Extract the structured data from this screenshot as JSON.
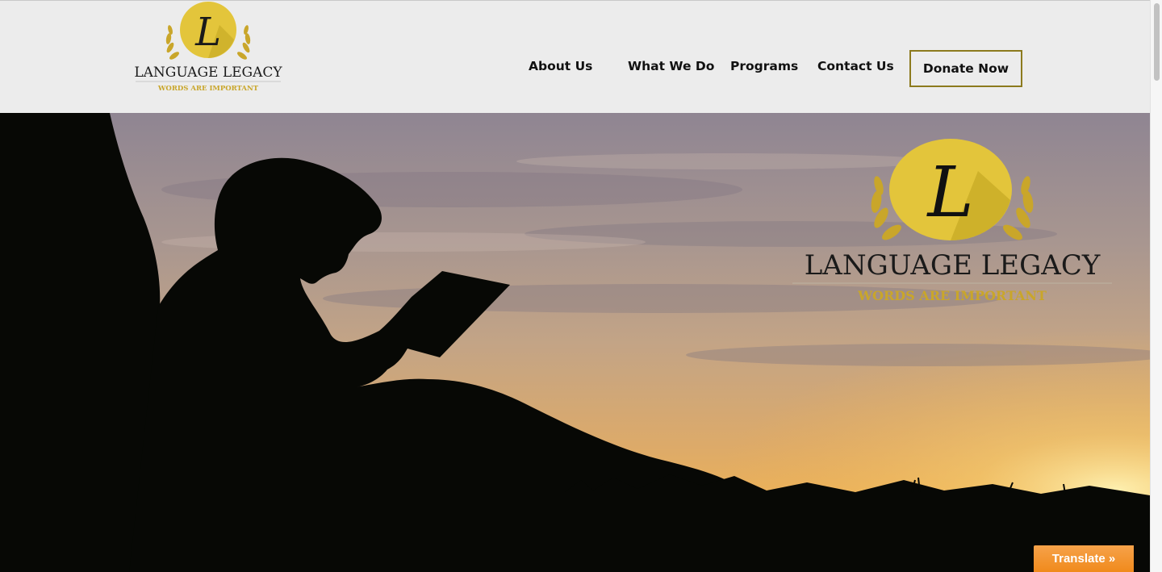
{
  "brand": {
    "monogram": "L",
    "name": "LANGUAGE LEGACY",
    "tagline": "WORDS ARE IMPORTANT"
  },
  "nav": {
    "items": [
      {
        "label": "About Us"
      },
      {
        "label": "What We Do"
      },
      {
        "label": "Programs"
      },
      {
        "label": "Contact Us"
      }
    ],
    "donate_label": "Donate Now"
  },
  "hero": {
    "logo_monogram": "L",
    "logo_name": "LANGUAGE LEGACY",
    "logo_tagline": "WORDS ARE IMPORTANT"
  },
  "translate": {
    "label": "Translate »"
  },
  "colors": {
    "header_bg": "#ececec",
    "gold": "#e3c53b",
    "gold_dark": "#b89c1e",
    "tagline_gold": "#c9a62a",
    "button_border": "#8c7a1d",
    "translate_orange": "#f08a1c",
    "silhouette": "#070805"
  },
  "icons": {
    "logo": "laurel-monogram-icon",
    "scroll": "scrollbar-thumb"
  }
}
